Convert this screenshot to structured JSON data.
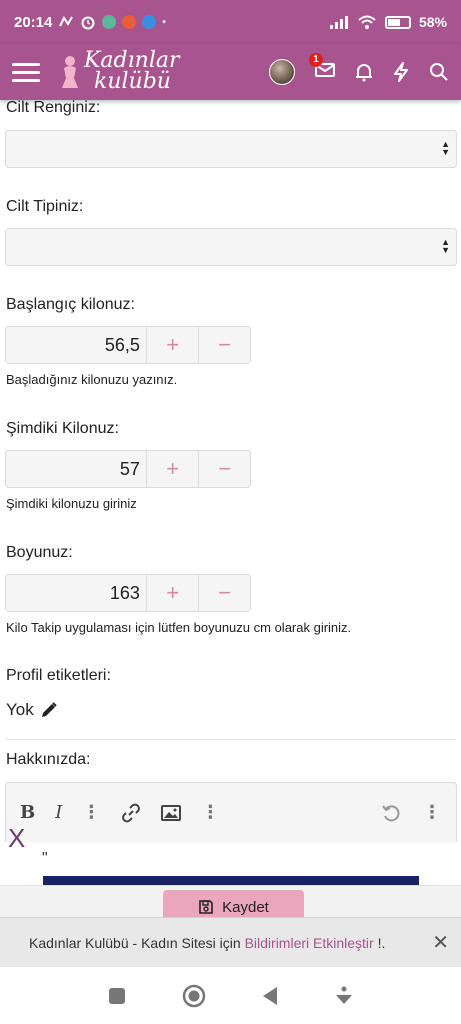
{
  "status": {
    "time": "20:14",
    "battery": "58%"
  },
  "app": {
    "logo_line1": "Kadınlar",
    "logo_line2": "kulübü",
    "mail_badge": "1"
  },
  "form": {
    "skin_color_label": "Cilt Renginiz:",
    "skin_type_label": "Cilt Tipiniz:",
    "start_weight_label": "Başlangıç kilonuz:",
    "start_weight_value": "56,5",
    "start_weight_hint": "Başladığınız kilonuzu yazınız.",
    "current_weight_label": "Şimdiki Kilonuz:",
    "current_weight_value": "57",
    "current_weight_hint": "Şimdiki kilonuzu giriniz",
    "height_label": "Boyunuz:",
    "height_value": "163",
    "height_hint": "Kilo Takip uygulaması için lütfen boyunuzu cm olarak giriniz.",
    "plus": "+",
    "minus": "−",
    "profile_tags_label": "Profil etiketleri:",
    "profile_tags_value": "Yok",
    "about_label": "Hakkınızda:",
    "editor_quote": "\""
  },
  "overlay": {
    "close_text": "X"
  },
  "save": {
    "label": "Kaydet"
  },
  "notification": {
    "text_prefix": "Kadınlar Kulübü - Kadın Sitesi için ",
    "link_text": "Bildirimleri Etkinleştir",
    "text_suffix": " !."
  },
  "colors": {
    "brand": "#a7548f",
    "button_pink": "#e9a6bc",
    "step_icon": "#d78aa2"
  },
  "icons": [
    "hamburger-icon",
    "mail-icon",
    "bell-icon",
    "bolt-icon",
    "search-icon",
    "pencil-icon",
    "link-icon",
    "image-icon",
    "undo-icon",
    "save-icon",
    "close-icon",
    "square-nav-icon",
    "home-nav-icon",
    "back-nav-icon",
    "menu-nav-icon"
  ]
}
